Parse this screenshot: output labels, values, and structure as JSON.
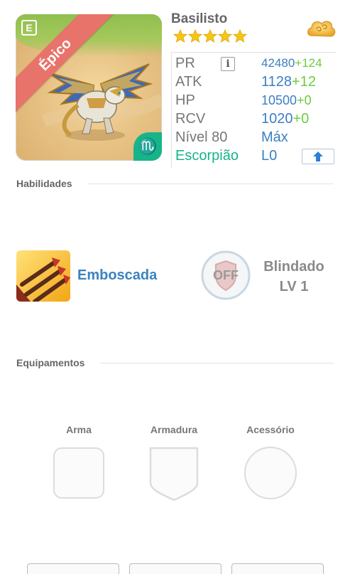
{
  "monster": {
    "name": "Basilisto",
    "rarity": "Épico",
    "star_count": 5,
    "element_symbol": "♏",
    "deck_icon": "deck-icon",
    "extra_icon": "cloud-icon"
  },
  "stats": {
    "pr": {
      "label": "PR",
      "value": "42480",
      "bonus": "+124"
    },
    "atk": {
      "label": "ATK",
      "value": "1128",
      "bonus": "+12"
    },
    "hp": {
      "label": "HP",
      "value": "10500",
      "bonus": "+0"
    },
    "rcv": {
      "label": "RCV",
      "value": "1020",
      "bonus": "+0"
    },
    "level": {
      "label": "Nível 80",
      "value": "Máx"
    },
    "sign": {
      "label": "Escorpião",
      "value": "L0"
    }
  },
  "sections": {
    "abilities": "Habilidades",
    "equipment": "Equipamentos"
  },
  "skill": {
    "name": "Emboscada"
  },
  "passive": {
    "badge": "OFF",
    "name": "Blindado",
    "level": "LV 1"
  },
  "equipment": {
    "slots": [
      {
        "label": "Arma"
      },
      {
        "label": "Armadura"
      },
      {
        "label": "Acessório"
      }
    ]
  },
  "colors": {
    "accent_blue": "#3b7fc3",
    "bonus_green": "#6ccc3f",
    "zodiac_teal": "#17b48a",
    "epic_ribbon": "#e7736a",
    "star_gold": "#f5c518"
  }
}
